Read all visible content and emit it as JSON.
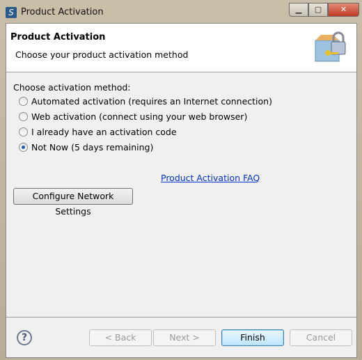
{
  "window": {
    "title": "Product Activation"
  },
  "header": {
    "title": "Product Activation",
    "subtitle": "Choose your product activation method",
    "icon": "lock-key-box-icon"
  },
  "body": {
    "label": "Choose activation method:",
    "options": [
      {
        "label": "Automated activation (requires an Internet connection)",
        "selected": false
      },
      {
        "label": "Web activation (connect using your web browser)",
        "selected": false
      },
      {
        "label": "I already have an activation code",
        "selected": false
      },
      {
        "label": "Not Now (5 days remaining)",
        "selected": true
      }
    ],
    "faq_link": "Product Activation FAQ",
    "network_button": "Configure Network Settings"
  },
  "footer": {
    "back": "< Back",
    "next": "Next >",
    "finish": "Finish",
    "cancel": "Cancel"
  }
}
